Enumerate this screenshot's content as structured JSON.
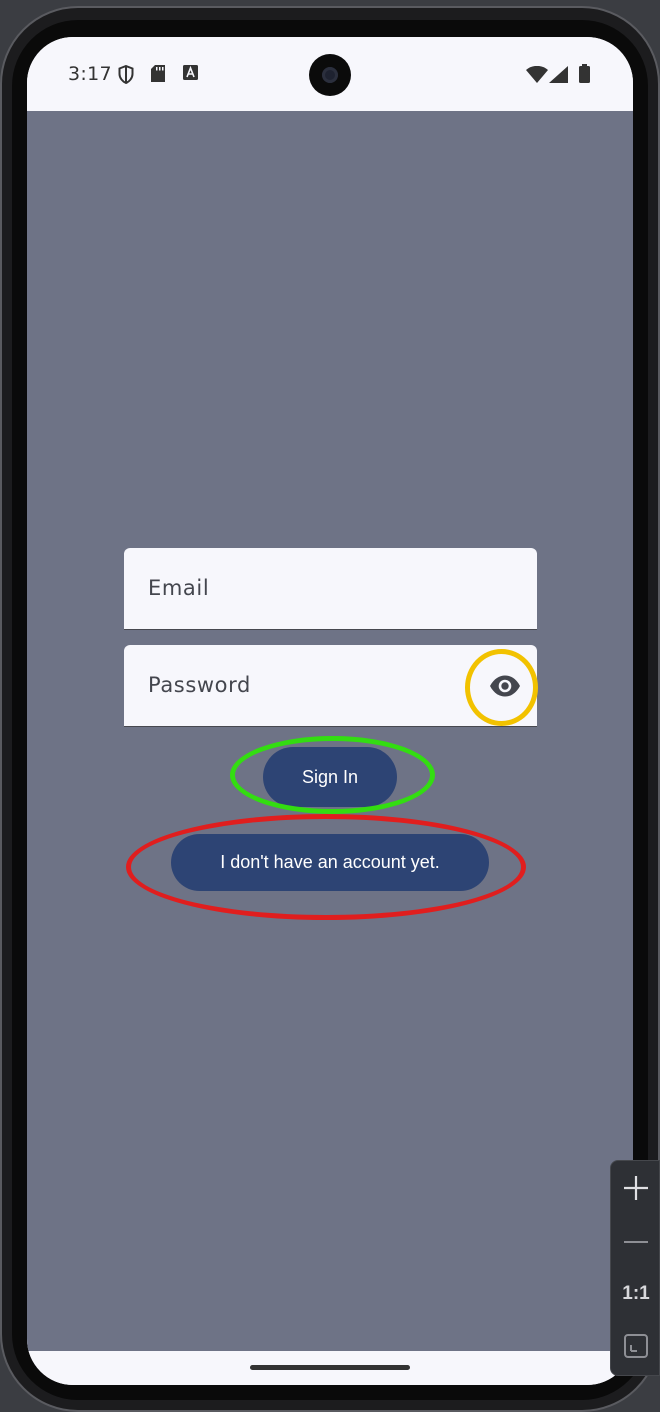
{
  "status_bar": {
    "time": "3:17"
  },
  "form": {
    "email_label": "Email",
    "password_label": "Password",
    "toggle_visibility_icon": "eye-icon"
  },
  "buttons": {
    "sign_in_label": "Sign In",
    "no_account_label": "I don't have an account yet."
  },
  "annotations": {
    "eye_circle_color": "#f2c200",
    "sign_in_circle_color": "#33dd11",
    "no_account_circle_color": "#e01e1e"
  },
  "zoom_controls": {
    "reset_label": "1:1"
  },
  "colors": {
    "app_background": "#6e7386",
    "button": "#2d4474",
    "field_background": "#f7f7fc"
  }
}
